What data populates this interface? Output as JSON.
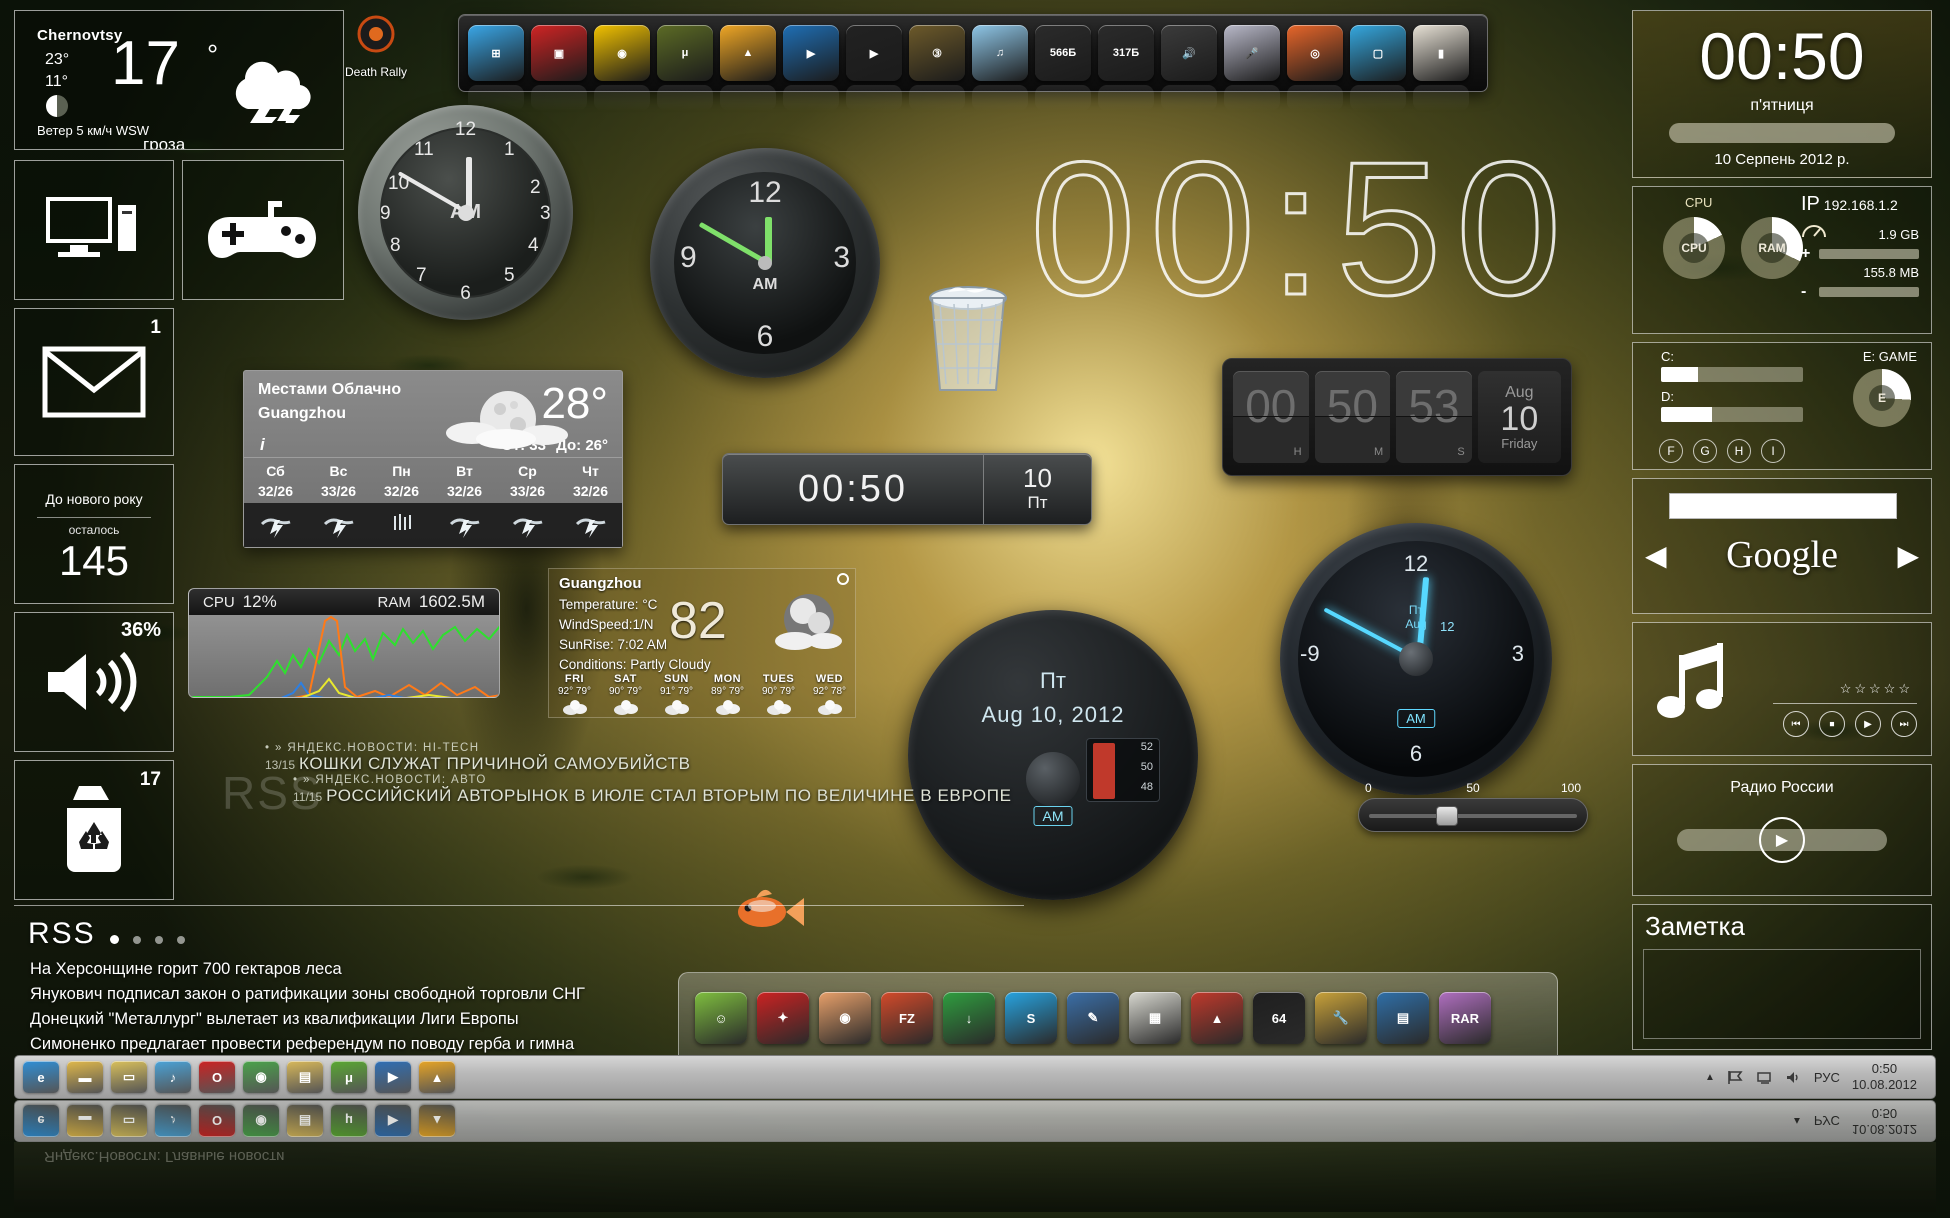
{
  "weather_tile": {
    "city": "Chernovtsy",
    "high": "23°",
    "low": "11°",
    "temp": "17",
    "degree": "°",
    "wind": "Ветер  5 км/ч  WSW",
    "condition": "гроза",
    "icon": "thunderstorm-cloud-icon"
  },
  "tiles": {
    "computer_icon": "computer-monitor-icon",
    "game_icon": "gamepad-icon",
    "mail_icon": "envelope-icon",
    "mail_count": "1",
    "newyear_title": "До нового року",
    "newyear_sub": "осталось",
    "newyear_days": "145",
    "volume_pct": "36%",
    "volume_icon": "speaker-icon",
    "recycle_icon": "recycle-bin-icon",
    "recycle_count": "17"
  },
  "desktop_icon": {
    "label": "Death Rally",
    "icon": "death-rally-icon"
  },
  "top_dock": {
    "items": [
      {
        "name": "start-orb",
        "glyph": "⊞",
        "color": "#3aa7e8"
      },
      {
        "name": "video-red-app",
        "glyph": "▣",
        "color": "#d02424"
      },
      {
        "name": "chrome",
        "glyph": "◉",
        "color": "#f2c200"
      },
      {
        "name": "tuxguitar",
        "glyph": "μ",
        "color": "#5c6b25"
      },
      {
        "name": "avast",
        "glyph": "▲",
        "color": "#f0a725"
      },
      {
        "name": "media-player-blue",
        "glyph": "▶",
        "color": "#1f6fb5"
      },
      {
        "name": "movie-clapper",
        "glyph": "▶",
        "color": "#222"
      },
      {
        "name": "film-reel",
        "glyph": "③",
        "color": "#6d5a2a"
      },
      {
        "name": "music-note-app",
        "glyph": "♫",
        "color": "#8fc7e8"
      },
      {
        "name": "drive-566gb",
        "glyph": "566Б",
        "color": "#2b2b2b"
      },
      {
        "name": "drive-317gb",
        "glyph": "317Б",
        "color": "#2b2b2b"
      },
      {
        "name": "speaker-app",
        "glyph": "🔊",
        "color": "#3b3b3b"
      },
      {
        "name": "microphone-app",
        "glyph": "🎤",
        "color": "#b9b9c9"
      },
      {
        "name": "firefox-app",
        "glyph": "◎",
        "color": "#e8662a"
      },
      {
        "name": "blue-square-app",
        "glyph": "▢",
        "color": "#35a8e0"
      },
      {
        "name": "photo-app",
        "glyph": "▮",
        "color": "#e8e2d6"
      }
    ]
  },
  "bottom_dock": {
    "items": [
      {
        "name": "green-face-app",
        "glyph": "☺",
        "color": "#7fbf3f"
      },
      {
        "name": "red-ladybug-app",
        "glyph": "✦",
        "color": "#cc2222"
      },
      {
        "name": "eye-app",
        "glyph": "◉",
        "color": "#e8a06a"
      },
      {
        "name": "filezilla-app",
        "glyph": "FZ",
        "color": "#d44a2a"
      },
      {
        "name": "download-app",
        "glyph": "↓",
        "color": "#2f9e3f"
      },
      {
        "name": "skype-app",
        "glyph": "S",
        "color": "#27a3e0"
      },
      {
        "name": "pen-app",
        "glyph": "✎",
        "color": "#3b6fa8"
      },
      {
        "name": "calculator-app",
        "glyph": "▦",
        "color": "#d8d8d0"
      },
      {
        "name": "rocket-app",
        "glyph": "▲",
        "color": "#c0392b"
      },
      {
        "name": "64-app",
        "glyph": "64",
        "color": "#1f1f1f"
      },
      {
        "name": "tools-app",
        "glyph": "🔧",
        "color": "#c9a23a"
      },
      {
        "name": "windows-tiles-app",
        "glyph": "▤",
        "color": "#2f6fa8"
      },
      {
        "name": "winrar-app",
        "glyph": "RAR",
        "color": "#b06fc0"
      }
    ]
  },
  "ghost_clock": "00:50",
  "digital_strip": {
    "time": "00:50",
    "day_num": "10",
    "day_name": "Пт"
  },
  "flip_clock": {
    "hours": "00",
    "hours_unit": "H",
    "minutes": "50",
    "minutes_unit": "M",
    "seconds": "53",
    "seconds_unit": "S",
    "month": "Aug",
    "day": "10",
    "weekday": "Friday"
  },
  "analog_clock_1": {
    "numbers": [
      "12",
      "1",
      "2",
      "3",
      "4",
      "5",
      "6",
      "7",
      "8",
      "9",
      "10",
      "11"
    ],
    "ampm": "AM"
  },
  "analog_clock_2": {
    "numbers": [
      "12",
      "3",
      "6",
      "9"
    ],
    "ampm": "AM",
    "hour_label": "6"
  },
  "analog_clock_blue": {
    "numbers": [
      "12",
      "3",
      "6",
      "-9"
    ],
    "ampm": "AM",
    "center_top": "Пт",
    "center_mid": "Aug",
    "center_right": "12"
  },
  "analog_clock_date": {
    "weekday": "Пт",
    "date": "Aug  10,  2012",
    "ampm": "AM",
    "gauge_values": [
      "52",
      "50",
      "48"
    ]
  },
  "weather_widget_2": {
    "condition": "Местами Облачно",
    "city": "Guangzhou",
    "temp": "28°",
    "range": "От: 33°  До: 26°",
    "info_glyph": "i",
    "days": [
      {
        "name": "Сб",
        "temp": "32/26",
        "icon": "storm-icon"
      },
      {
        "name": "Вс",
        "temp": "33/26",
        "icon": "storm-icon"
      },
      {
        "name": "Пн",
        "temp": "32/26",
        "icon": "rain-icon"
      },
      {
        "name": "Вт",
        "temp": "32/26",
        "icon": "storm-icon"
      },
      {
        "name": "Ср",
        "temp": "33/26",
        "icon": "storm-icon"
      },
      {
        "name": "Чт",
        "temp": "32/26",
        "icon": "storm-icon"
      }
    ]
  },
  "weather_widget_3": {
    "city": "Guangzhou",
    "temperature_label": "Temperature: °C",
    "windspeed_label": "WindSpeed:1/N",
    "sunrise_label": "SunRise: 7:02 AM",
    "conditions_label": "Conditions: Partly Cloudy",
    "temp": "82",
    "days": [
      {
        "name": "FRI",
        "hi": "92°",
        "lo": "79°"
      },
      {
        "name": "SAT",
        "hi": "90°",
        "lo": "79°"
      },
      {
        "name": "SUN",
        "hi": "91°",
        "lo": "79°"
      },
      {
        "name": "MON",
        "hi": "89°",
        "lo": "79°"
      },
      {
        "name": "TUES",
        "hi": "90°",
        "lo": "79°"
      },
      {
        "name": "WED",
        "hi": "92°",
        "lo": "78°"
      }
    ]
  },
  "cpu_graph": {
    "cpu_label": "CPU",
    "cpu_value": "12%",
    "ram_label": "RAM",
    "ram_value": "1602.5M"
  },
  "slider": {
    "min": "0",
    "mid": "50",
    "max": "100",
    "value": 34
  },
  "feed_top": [
    {
      "category": "» ЯНДЕКС.НОВОСТИ: HI-TECH",
      "count": "13/15",
      "headline": "КОШКИ СЛУЖАТ ПРИЧИНОЙ САМОУБИЙСТВ"
    },
    {
      "category": "» ЯНДЕКС.НОВОСТИ: АВТО",
      "count": "11/15",
      "headline": "РОССИЙСКИЙ АВТОРЫНОК В ИЮЛЕ СТАЛ ВТОРЫМ ПО ВЕЛИЧИНЕ В ЕВРОПЕ"
    }
  ],
  "rss": {
    "title": "RSS",
    "watermark": "RSS",
    "items": [
      "На Херсонщине горит 700 гектаров леса",
      "Янукович подписал закон о ратификации зоны свободной торговли СНГ",
      "Донецкий \"Металлург\" вылетает из квалификации Лиги Европы",
      "Симоненко предлагает провести референдум по поводу герба и гимна"
    ],
    "source": "Яндекс.Новости: Главные новости",
    "source_icon": "rss-feed-icon"
  },
  "right_sidebar": {
    "clock": {
      "time": "00:50",
      "weekday": "п'ятниця",
      "date": "10 Серпень 2012 р."
    },
    "system": {
      "cpu_label": "CPU",
      "cpu_donut_label": "CPU",
      "ram_donut_label": "RAM",
      "ip_prefix": "IP",
      "ip": "192.168.1.2",
      "gauge_icon": "speedometer-icon",
      "down_value": "1.9 GB",
      "up_value": "155.8 MB",
      "plus": "+",
      "minus": "-"
    },
    "drives": {
      "c_label": "C:",
      "c_fill": 26,
      "d_label": "D:",
      "d_fill": 36,
      "e_label": "E: GAME",
      "e_letter": "E",
      "others": [
        "F",
        "G",
        "H",
        "I"
      ]
    },
    "google": {
      "logo": "Google",
      "prev": "◀",
      "next": "▶",
      "search_value": "",
      "search_placeholder": ""
    },
    "music": {
      "note_icon": "music-note-icon",
      "stars": "☆☆☆☆☆",
      "buttons": [
        "⏮",
        "⏹",
        "▶",
        "⏭"
      ]
    },
    "radio": {
      "name": "Радио России",
      "play_icon": "play-icon"
    },
    "note": {
      "title": "Заметка",
      "text": ""
    }
  },
  "taskbar": {
    "items": [
      {
        "name": "internet-explorer",
        "glyph": "e",
        "color": "#2f8fd6"
      },
      {
        "name": "folder-explorer",
        "glyph": "▬",
        "color": "#e0b84a"
      },
      {
        "name": "folder-yellow",
        "glyph": "▭",
        "color": "#d9c05c"
      },
      {
        "name": "music-player",
        "glyph": "♪",
        "color": "#4aa3d8"
      },
      {
        "name": "opera-browser",
        "glyph": "O",
        "color": "#cc2222"
      },
      {
        "name": "chrome-browser",
        "glyph": "◉",
        "color": "#4aa34a"
      },
      {
        "name": "folder-docs",
        "glyph": "▤",
        "color": "#d8b85a"
      },
      {
        "name": "utorrent",
        "glyph": "μ",
        "color": "#5aa832"
      },
      {
        "name": "media-player",
        "glyph": "▶",
        "color": "#2f6fb5"
      },
      {
        "name": "avast-antivirus",
        "glyph": "▲",
        "color": "#e8a525"
      }
    ],
    "tray": {
      "chevron": "▲",
      "icons": [
        "flag-icon",
        "network-icon",
        "volume-icon"
      ],
      "language": "РУС",
      "time": "0:50",
      "date": "10.08.2012"
    }
  }
}
